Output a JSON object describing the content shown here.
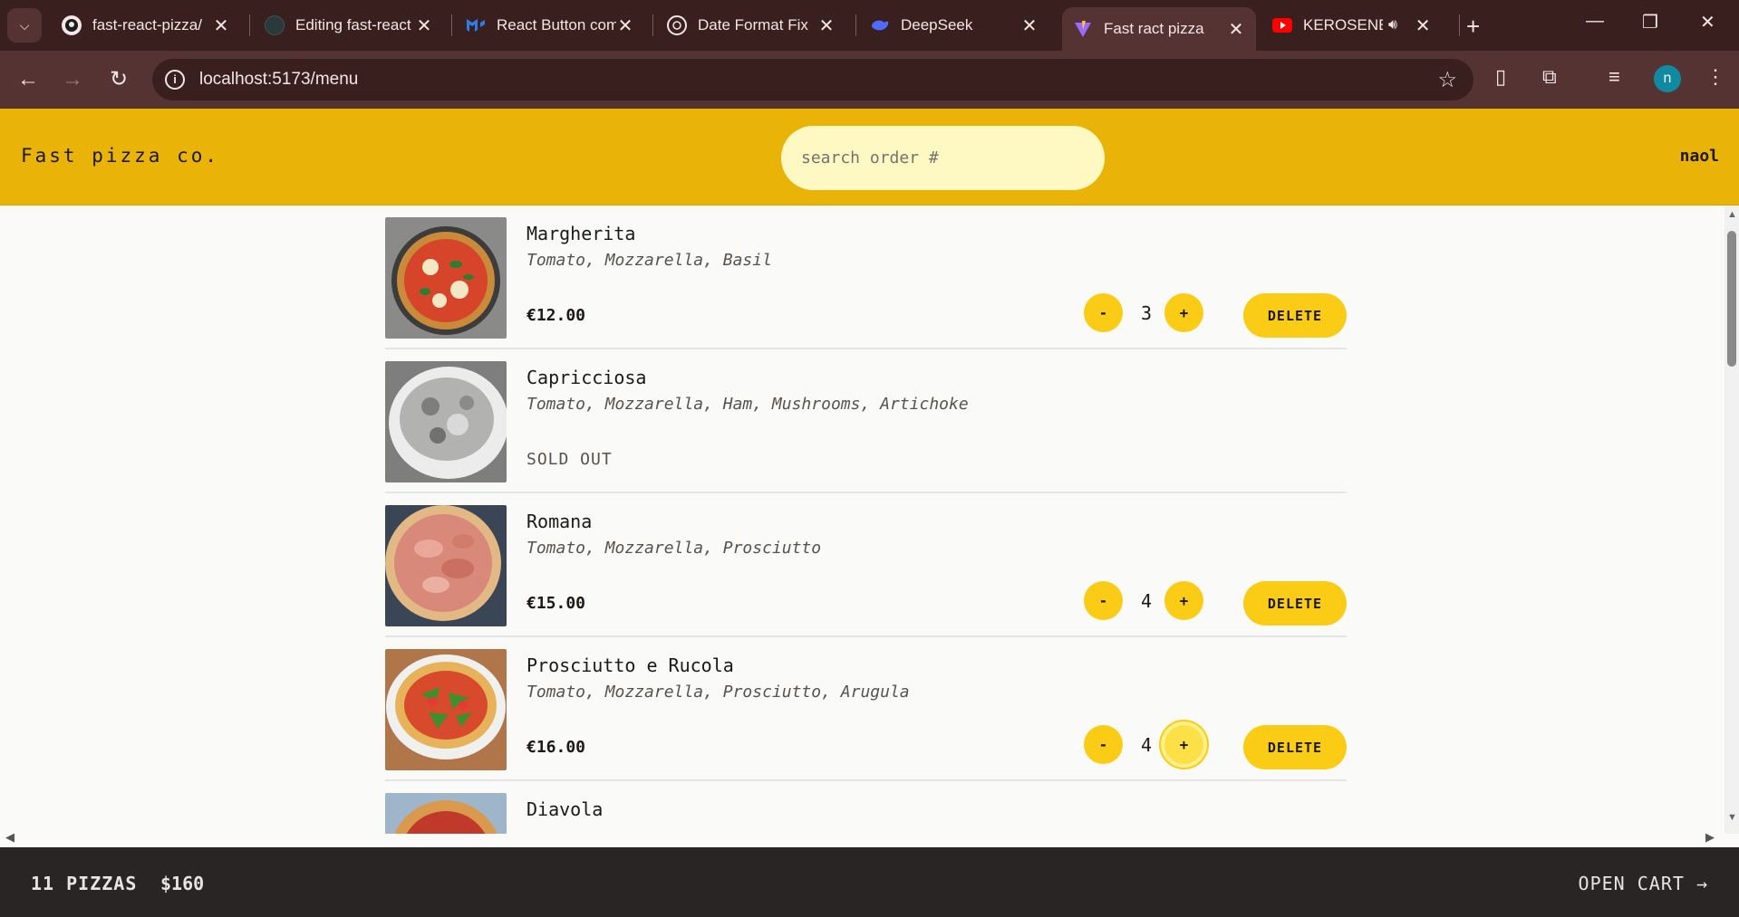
{
  "browser": {
    "tabs": [
      {
        "title": "fast-react-pizza/",
        "favicon": "github-icon",
        "active": false
      },
      {
        "title": "Editing fast-react",
        "favicon": "github-icon",
        "active": false
      },
      {
        "title": "React Button com",
        "favicon": "mui-icon",
        "active": false
      },
      {
        "title": "Date Format Fix",
        "favicon": "openai-icon",
        "active": false
      },
      {
        "title": "DeepSeek",
        "favicon": "deepseek-icon",
        "active": false
      },
      {
        "title": "Fast ract pizza",
        "favicon": "vite-icon",
        "active": true
      },
      {
        "title": "KEROSENE (U",
        "favicon": "youtube-icon",
        "active": false,
        "audio": true
      }
    ],
    "url": "localhost:5173/menu",
    "profile_initial": "n"
  },
  "header": {
    "logo": "Fast pizza co.",
    "search_placeholder": "search order #",
    "username": "naol"
  },
  "menu": [
    {
      "name": "Margherita",
      "ingredients": "Tomato, Mozzarella, Basil",
      "price": "€12.00",
      "quantity": "3",
      "sold_out": false
    },
    {
      "name": "Capricciosa",
      "ingredients": "Tomato, Mozzarella, Ham, Mushrooms, Artichoke",
      "sold_out_label": "SOLD OUT",
      "sold_out": true
    },
    {
      "name": "Romana",
      "ingredients": "Tomato, Mozzarella, Prosciutto",
      "price": "€15.00",
      "quantity": "4",
      "sold_out": false
    },
    {
      "name": "Prosciutto e Rucola",
      "ingredients": "Tomato, Mozzarella, Prosciutto, Arugula",
      "price": "€16.00",
      "quantity": "4",
      "sold_out": false
    },
    {
      "name": "Diavola",
      "sold_out": false
    }
  ],
  "buttons": {
    "decrease": "-",
    "increase": "+",
    "delete": "DELETE"
  },
  "cart": {
    "count": "11 PIZZAS",
    "total": "$160",
    "open_label": "OPEN CART →"
  },
  "colors": {
    "header_bg": "#eab308",
    "button_bg": "#facc15",
    "cart_bg": "#292524"
  }
}
